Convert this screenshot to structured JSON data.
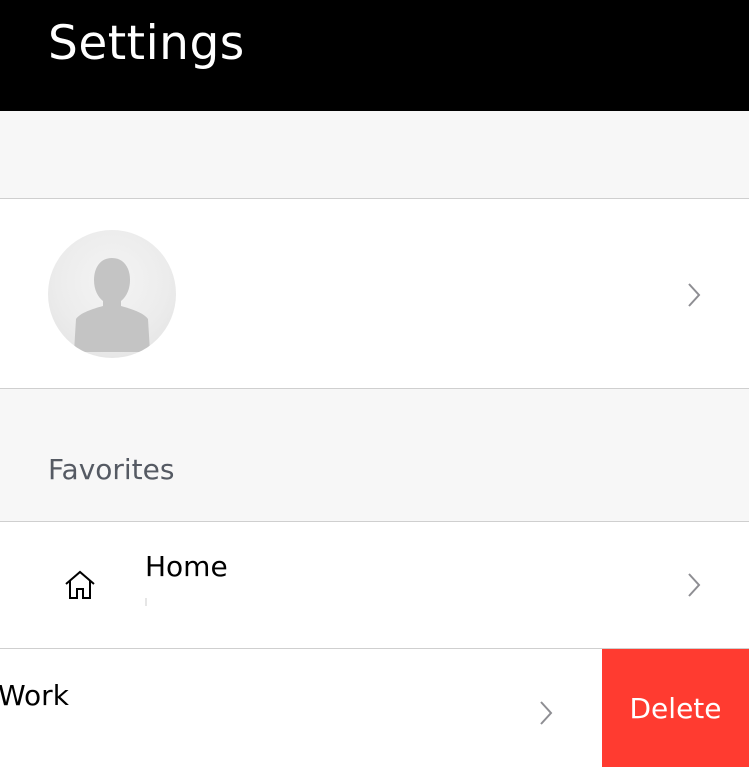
{
  "header": {
    "title": "Settings"
  },
  "profile": {
    "avatar_icon": "person-silhouette-icon",
    "chevron_icon": "chevron-right-icon"
  },
  "favorites": {
    "section_title": "Favorites",
    "items": [
      {
        "label": "Home",
        "icon": "home-icon",
        "chevron_icon": "chevron-right-icon"
      },
      {
        "label": "Work",
        "chevron_icon": "chevron-right-icon",
        "delete_label": "Delete"
      }
    ]
  },
  "colors": {
    "header_bg": "#000000",
    "section_bg": "#f7f7f7",
    "delete_bg": "#ff3b30",
    "divider": "#cfcfcf",
    "chevron": "#8e8e93"
  }
}
